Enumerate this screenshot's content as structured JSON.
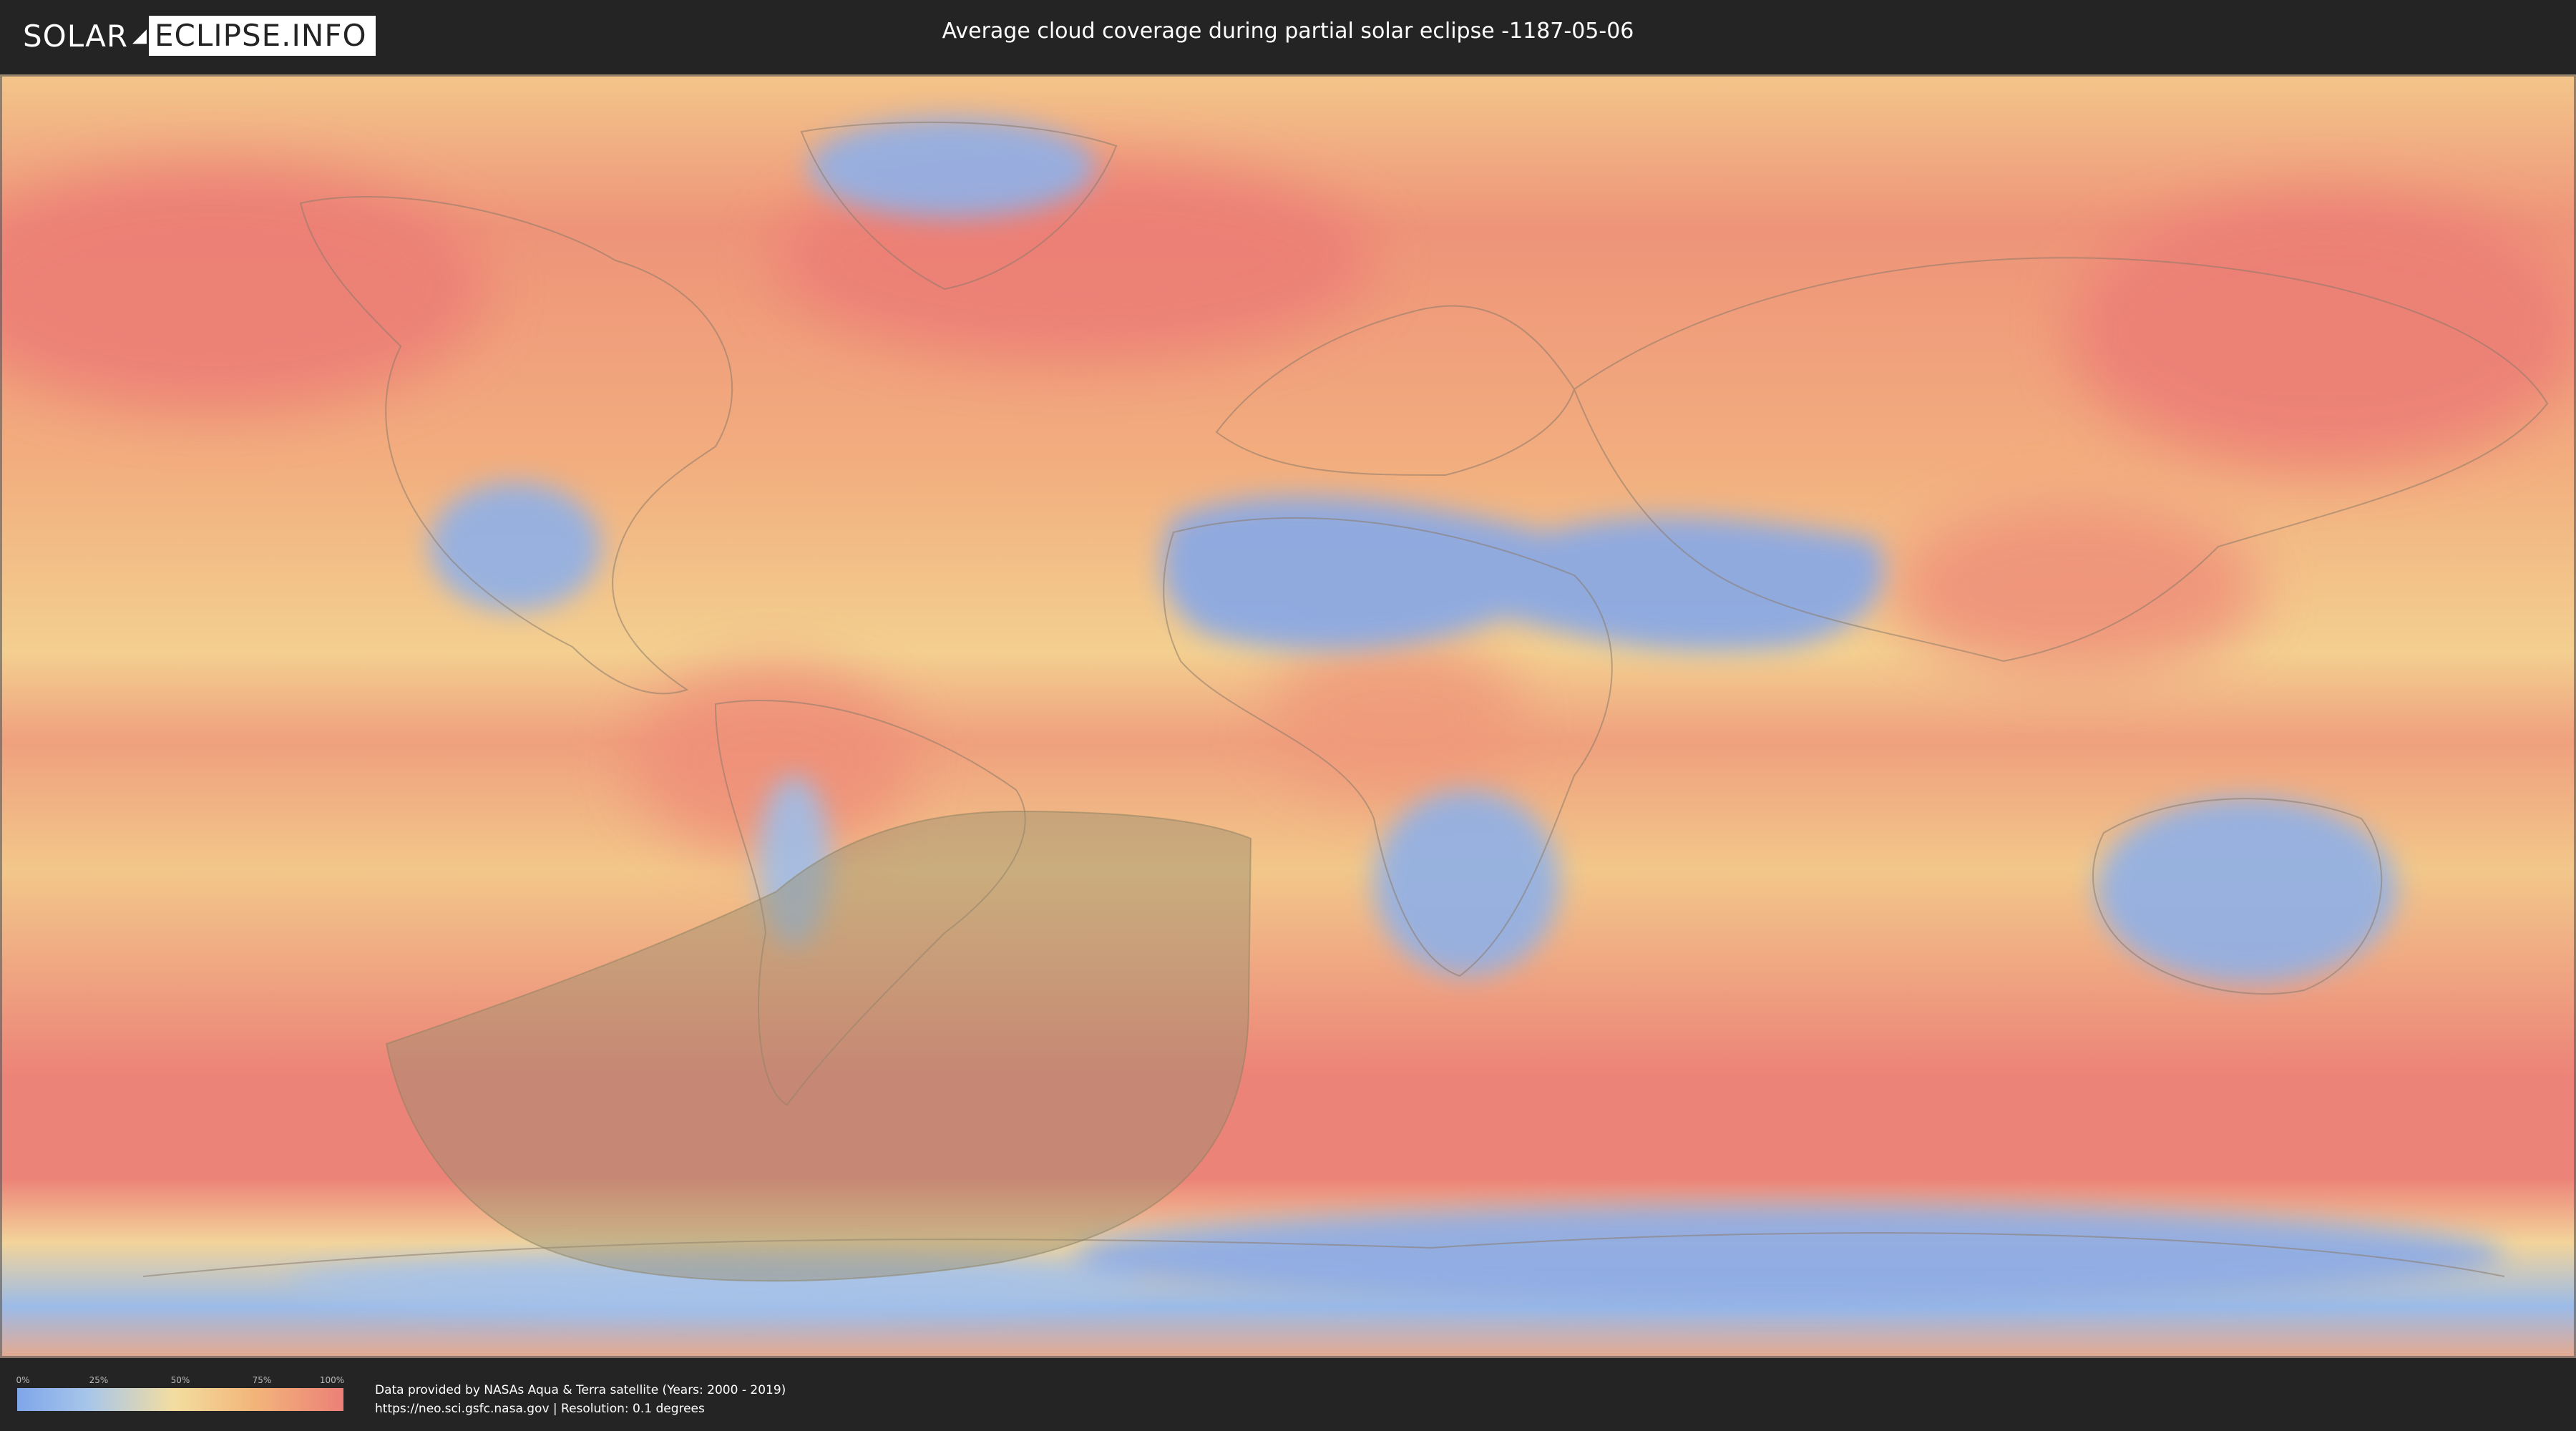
{
  "header": {
    "logo_part1": "SOLAR",
    "logo_part2": "ECLIPSE.INFO",
    "title": "Average cloud coverage during partial solar eclipse -1187-05-06"
  },
  "map": {
    "type": "cloud coverage world map",
    "eclipse_visibility_region_color": "#9a8f6f",
    "coverage_colors": {
      "low": "#7ea6ea",
      "mid_low": "#a8c6ea",
      "mid": "#f3dda0",
      "mid_high": "#f3b67a",
      "high": "#ec8078"
    }
  },
  "legend": {
    "ticks": [
      "0%",
      "25%",
      "50%",
      "75%",
      "100%"
    ]
  },
  "footer": {
    "credit_line1": "Data provided by NASAs Aqua & Terra satellite (Years: 2000 - 2019)",
    "credit_line2": "https://neo.sci.gsfc.nasa.gov | Resolution: 0.1 degrees"
  }
}
